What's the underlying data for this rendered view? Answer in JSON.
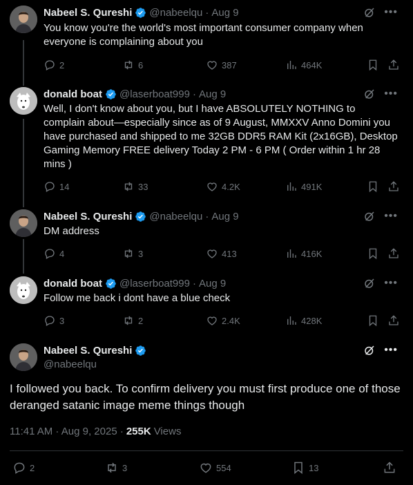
{
  "tweets": [
    {
      "name": "Nabeel S. Qureshi",
      "handle": "@nabeelqu",
      "date": "Aug 9",
      "text": "You know you're the world's most important consumer company when everyone is complaining about you",
      "replies": "2",
      "reposts": "6",
      "likes": "387",
      "views": "464K"
    },
    {
      "name": "donald boat",
      "handle": "@laserboat999",
      "date": "Aug 9",
      "text": "Well, I don't know about you, but I have ABSOLUTELY NOTHING to complain about—especially since as of 9 August, MMXXV Anno Domini you have purchased and shipped to me 32GB DDR5 RAM Kit (2x16GB), Desktop Gaming Memory FREE delivery Today 2 PM - 6 PM ( Order within 1 hr 28 mins )",
      "replies": "14",
      "reposts": "33",
      "likes": "4.2K",
      "views": "491K"
    },
    {
      "name": "Nabeel S. Qureshi",
      "handle": "@nabeelqu",
      "date": "Aug 9",
      "text": "DM address",
      "replies": "4",
      "reposts": "3",
      "likes": "413",
      "views": "416K"
    },
    {
      "name": "donald boat",
      "handle": "@laserboat999",
      "date": "Aug 9",
      "text": "Follow me back i dont have a blue check",
      "replies": "3",
      "reposts": "2",
      "likes": "2.4K",
      "views": "428K"
    }
  ],
  "main": {
    "name": "Nabeel S. Qureshi",
    "handle": "@nabeelqu",
    "text": "I followed you back. To confirm delivery you must first produce one of those deranged satanic image meme things though",
    "time": "11:41 AM · Aug 9, 2025 ·",
    "views_count": "255K",
    "views_label": "Views",
    "replies": "2",
    "reposts": "3",
    "likes": "554",
    "bookmarks": "13"
  },
  "colors": {
    "background": "#000000",
    "text": "#e7e9ea",
    "muted": "#71767b",
    "verified": "#1d9bf0",
    "divider": "#2f3336"
  },
  "icons": [
    "verified-badge-icon",
    "grok-icon",
    "more-icon",
    "reply-icon",
    "repost-icon",
    "like-icon",
    "views-icon",
    "bookmark-icon",
    "share-icon"
  ]
}
